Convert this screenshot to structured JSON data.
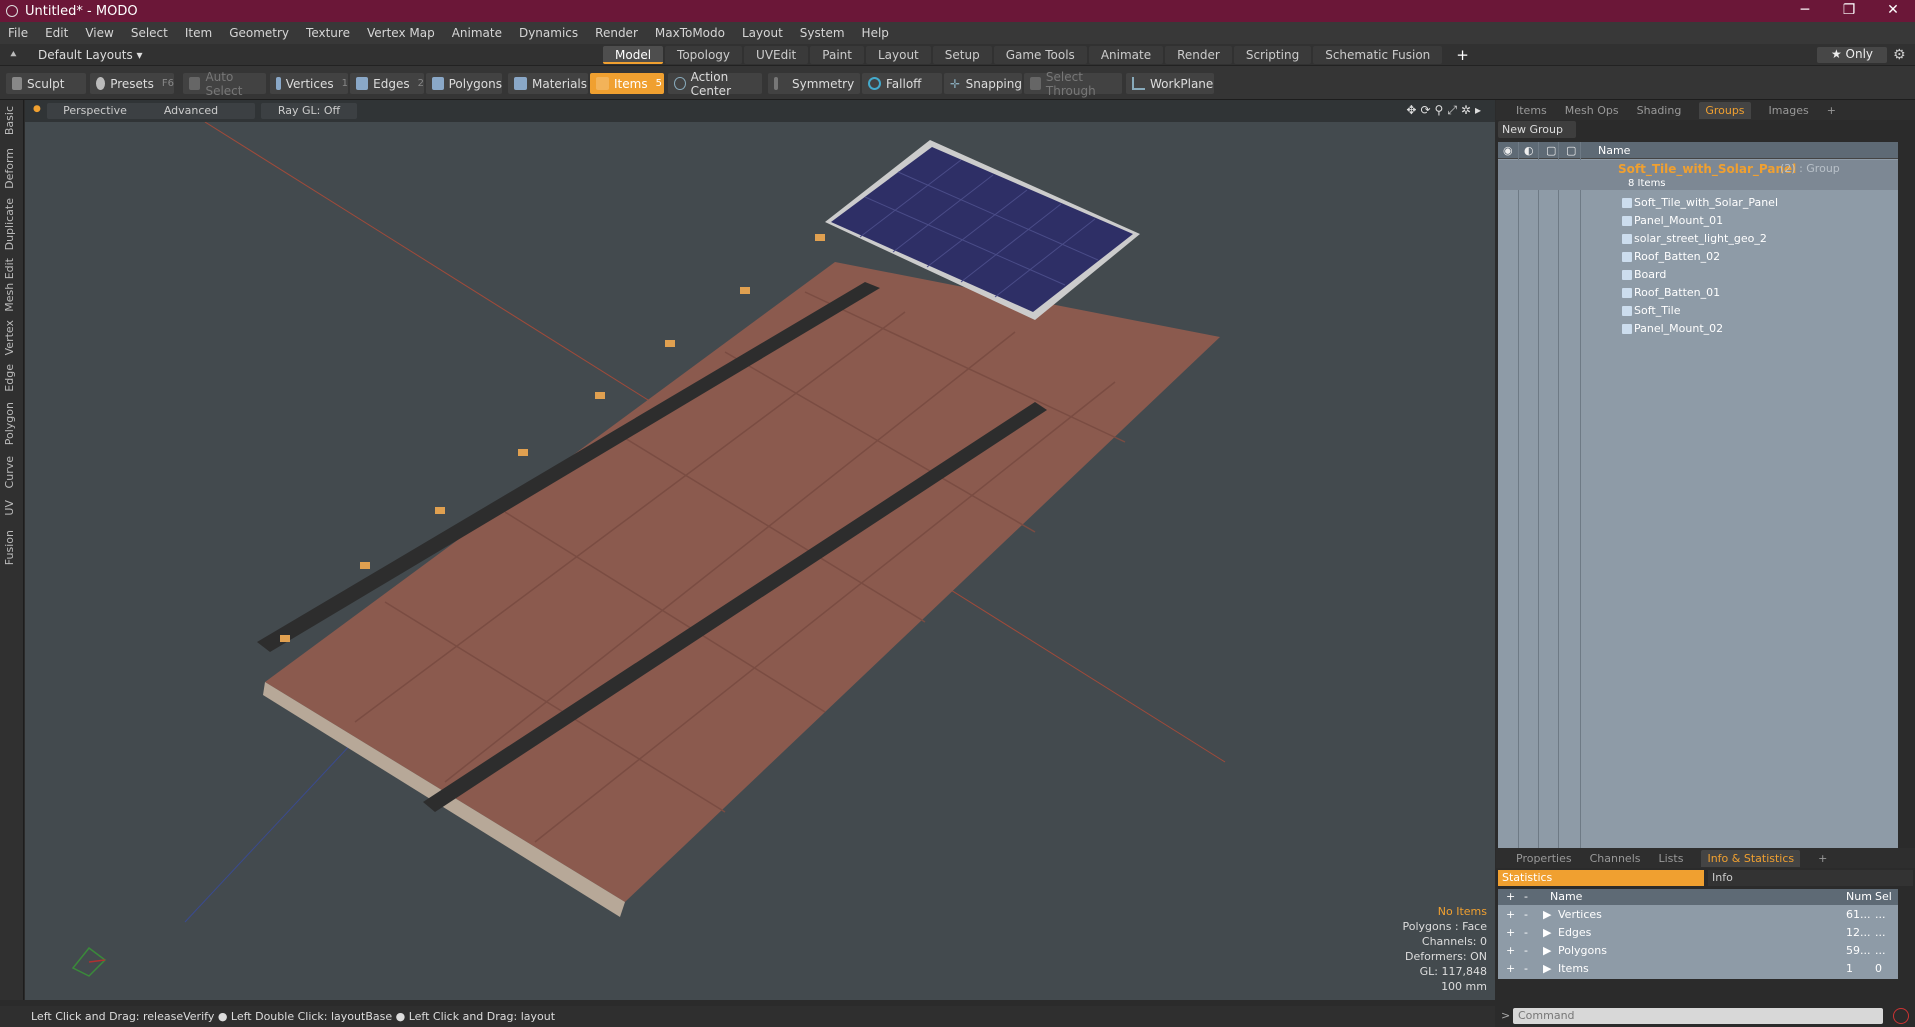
{
  "window": {
    "title": "Untitled* - MODO",
    "min": "─",
    "max": "❐",
    "close": "✕"
  },
  "menu": [
    "File",
    "Edit",
    "View",
    "Select",
    "Item",
    "Geometry",
    "Texture",
    "Vertex Map",
    "Animate",
    "Dynamics",
    "Render",
    "MaxToModo",
    "Layout",
    "System",
    "Help"
  ],
  "layouts": {
    "current": "Default Layouts ▾",
    "tabs": [
      "Model",
      "Topology",
      "UVEdit",
      "Paint",
      "Layout",
      "Setup",
      "Game Tools",
      "Animate",
      "Render",
      "Scripting",
      "Schematic Fusion"
    ],
    "add": "+",
    "only": "★ Only"
  },
  "toolbar": {
    "sculpt": "Sculpt",
    "presets": "Presets",
    "presets_key": "F6",
    "auto_select": "Auto Select",
    "vertices": "Vertices",
    "vertices_key": "1",
    "edges": "Edges",
    "edges_key": "2",
    "polygons": "Polygons",
    "materials": "Materials",
    "items": "Items",
    "items_key": "5",
    "action_center": "Action Center",
    "symmetry": "Symmetry",
    "falloff": "Falloff",
    "snapping": "Snapping",
    "select_through": "Select Through",
    "workplane": "WorkPlane"
  },
  "left_tabs": [
    "Basic",
    "Deform",
    "Duplicate",
    "Mesh Edit",
    "Vertex",
    "Edge",
    "Polygon",
    "Curve",
    "UV",
    "Fusion"
  ],
  "viewport": {
    "view": "Perspective",
    "shading": "Advanced",
    "raygl": "Ray GL: Off",
    "info": [
      "No Items",
      "Polygons : Face",
      "Channels: 0",
      "Deformers: ON",
      "GL: 117,848",
      "100 mm"
    ]
  },
  "panel_tabs": [
    "Items",
    "Mesh Ops",
    "Shading",
    "Groups",
    "Images",
    "+"
  ],
  "groups": {
    "new_group": "New Group",
    "col_name": "Name",
    "group_name": "Soft_Tile_with_Solar_Panel",
    "group_suffix": "(2) : Group",
    "group_count": "8 Items",
    "items": [
      "Soft_Tile_with_Solar_Panel",
      "Panel_Mount_01",
      "solar_street_light_geo_2",
      "Roof_Batten_02",
      "Board",
      "Roof_Batten_01",
      "Soft_Tile",
      "Panel_Mount_02"
    ]
  },
  "bottom_tabs": [
    "Properties",
    "Channels",
    "Lists",
    "Info & Statistics",
    "+"
  ],
  "stats": {
    "tab_stats": "Statistics",
    "tab_info": "Info",
    "col_name": "Name",
    "col_num": "Num",
    "col_sel": "Sel",
    "rows": [
      {
        "name": "Vertices",
        "num": "61...",
        "sel": "..."
      },
      {
        "name": "Edges",
        "num": "12...",
        "sel": "..."
      },
      {
        "name": "Polygons",
        "num": "59...",
        "sel": "..."
      },
      {
        "name": "Items",
        "num": "1",
        "sel": "0"
      }
    ]
  },
  "command": {
    "placeholder": "Command"
  },
  "status": "Left Click and Drag: releaseVerify ● Left Double Click: layoutBase ● Left Click and Drag: layout"
}
